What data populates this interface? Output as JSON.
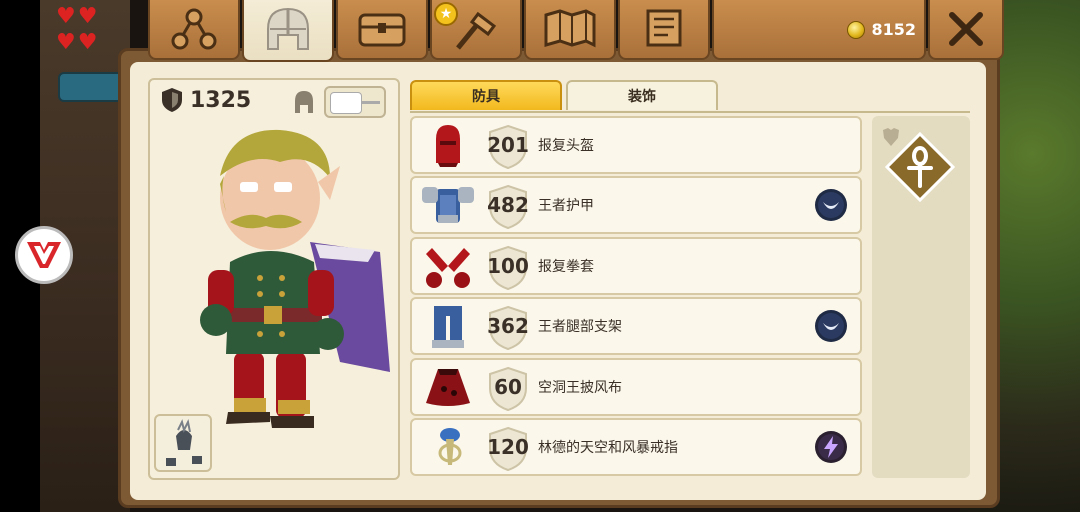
{
  "hud": {
    "hearts": [
      "♥",
      "♥",
      "♥",
      "♥"
    ]
  },
  "tabs": [
    {
      "name": "skills",
      "icon": "skill-tree-icon"
    },
    {
      "name": "equipment",
      "icon": "helmet-icon",
      "active": true
    },
    {
      "name": "inventory",
      "icon": "chest-icon"
    },
    {
      "name": "crafting",
      "icon": "hammer-icon",
      "starred": true
    },
    {
      "name": "map",
      "icon": "map-icon"
    },
    {
      "name": "quests",
      "icon": "scroll-icon"
    }
  ],
  "currency": {
    "amount": "8152",
    "icon": "coin-icon"
  },
  "character": {
    "armor_total": "1325"
  },
  "subtabs": {
    "armor": "防具",
    "cosmetics": "装饰"
  },
  "items": [
    {
      "value": "201",
      "name": "报复头盔",
      "color": "#b3171b",
      "badge": ""
    },
    {
      "value": "482",
      "name": "王者护甲",
      "color": "#3a5f9e",
      "badge": "moon"
    },
    {
      "value": "100",
      "name": "报复拳套",
      "color": "#b3171b",
      "badge": ""
    },
    {
      "value": "362",
      "name": "王者腿部支架",
      "color": "#3a5f9e",
      "badge": "moon"
    },
    {
      "value": "60",
      "name": "空洞王披风布",
      "color": "#8a1216",
      "badge": ""
    },
    {
      "value": "120",
      "name": "林德的天空和风暴戒指",
      "color": "#3a70c0",
      "badge": "lightning"
    }
  ],
  "colors": {
    "accent": "#f2b91e",
    "panel": "#f4ecd6",
    "wood": "#a9703a"
  }
}
